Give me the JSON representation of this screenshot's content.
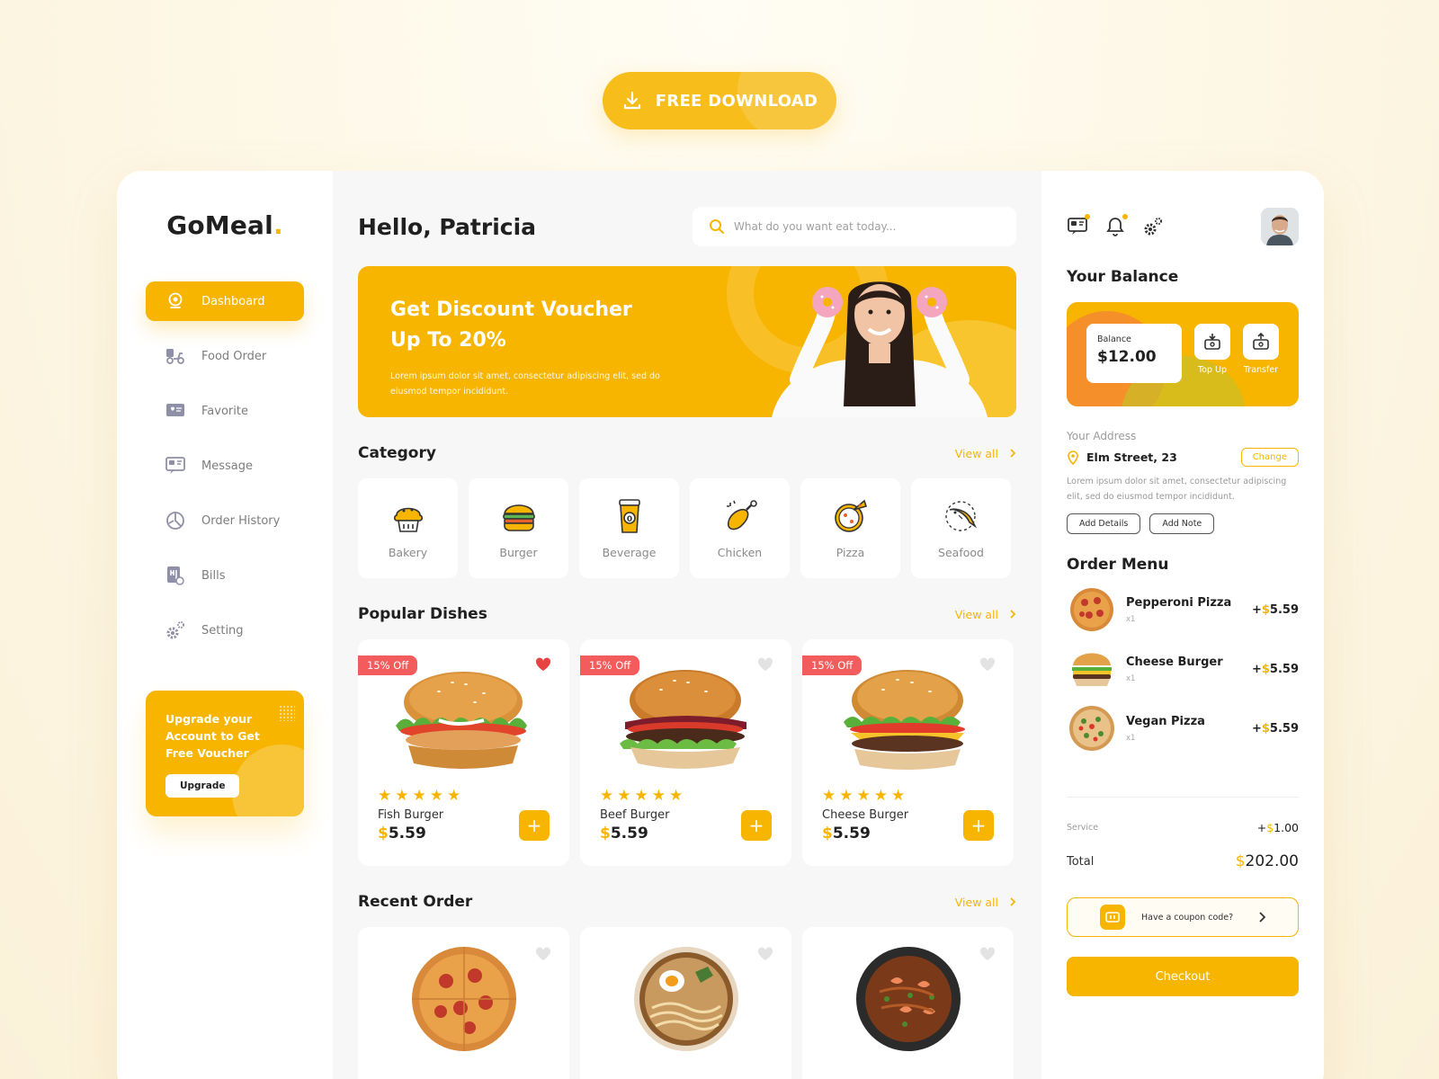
{
  "download_label": "FREE DOWNLOAD",
  "brand": {
    "name": "GoMeal",
    "dot": "."
  },
  "sidebar": {
    "items": [
      {
        "label": "Dashboard",
        "icon": "dashboard-icon",
        "active": true
      },
      {
        "label": "Food Order",
        "icon": "food-order-icon"
      },
      {
        "label": "Favorite",
        "icon": "favorite-icon"
      },
      {
        "label": "Message",
        "icon": "message-icon"
      },
      {
        "label": "Order History",
        "icon": "order-history-icon"
      },
      {
        "label": "Bills",
        "icon": "bills-icon"
      },
      {
        "label": "Setting",
        "icon": "setting-icon"
      }
    ],
    "upgrade": {
      "text": "Upgrade your Account to Get Free Voucher",
      "button": "Upgrade"
    }
  },
  "header": {
    "greeting": "Hello, Patricia",
    "search_placeholder": "What do you want eat today..."
  },
  "banner": {
    "title": "Get Discount Voucher Up To 20%",
    "text": "Lorem ipsum dolor sit amet, consectetur adipiscing elit, sed do eiusmod tempor incididunt."
  },
  "category": {
    "title": "Category",
    "view_all": "View all",
    "items": [
      {
        "label": "Bakery",
        "icon": "bakery-icon"
      },
      {
        "label": "Burger",
        "icon": "burger-icon"
      },
      {
        "label": "Beverage",
        "icon": "beverage-icon"
      },
      {
        "label": "Chicken",
        "icon": "chicken-icon"
      },
      {
        "label": "Pizza",
        "icon": "pizza-icon"
      },
      {
        "label": "Seafood",
        "icon": "seafood-icon"
      }
    ]
  },
  "popular": {
    "title": "Popular Dishes",
    "view_all": "View all",
    "dishes": [
      {
        "name": "Fish Burger",
        "currency": "$",
        "price": "5.59",
        "badge": "15% Off",
        "rating": 5,
        "favorite": true
      },
      {
        "name": "Beef Burger",
        "currency": "$",
        "price": "5.59",
        "badge": "15% Off",
        "rating": 5,
        "favorite": false
      },
      {
        "name": "Cheese Burger",
        "currency": "$",
        "price": "5.59",
        "badge": "15% Off",
        "rating": 5,
        "favorite": false
      }
    ]
  },
  "recent": {
    "title": "Recent Order",
    "view_all": "View all",
    "items": [
      {
        "icon": "pizza-image"
      },
      {
        "icon": "ramen-image"
      },
      {
        "icon": "stir-fry-image"
      }
    ]
  },
  "right": {
    "balance_title": "Your Balance",
    "balance_label": "Balance",
    "balance_amount": "$12.00",
    "top_up": "Top Up",
    "transfer": "Transfer",
    "address_label": "Your Address",
    "address": "Elm Street, 23",
    "change": "Change",
    "address_desc": "Lorem ipsum dolor sit amet, consectetur adipiscing elit, sed do eiusmod tempor incididunt.",
    "add_details": "Add Details",
    "add_note": "Add Note",
    "order_title": "Order Menu",
    "orders": [
      {
        "name": "Pepperoni Pizza",
        "qty": "x1",
        "sign": "+",
        "currency": "$",
        "price": "5.59"
      },
      {
        "name": "Cheese Burger",
        "qty": "x1",
        "sign": "+",
        "currency": "$",
        "price": "5.59"
      },
      {
        "name": "Vegan Pizza",
        "qty": "x1",
        "sign": "+",
        "currency": "$",
        "price": "5.59"
      }
    ],
    "service_label": "Service",
    "service_sign": "+",
    "service_currency": "$",
    "service_value": "1.00",
    "total_label": "Total",
    "total_currency": "$",
    "total_value": "202.00",
    "coupon": "Have a coupon code?",
    "checkout": "Checkout"
  },
  "colors": {
    "accent": "#f7b500",
    "badge": "#f25c5c",
    "heart_active": "#e84343"
  }
}
